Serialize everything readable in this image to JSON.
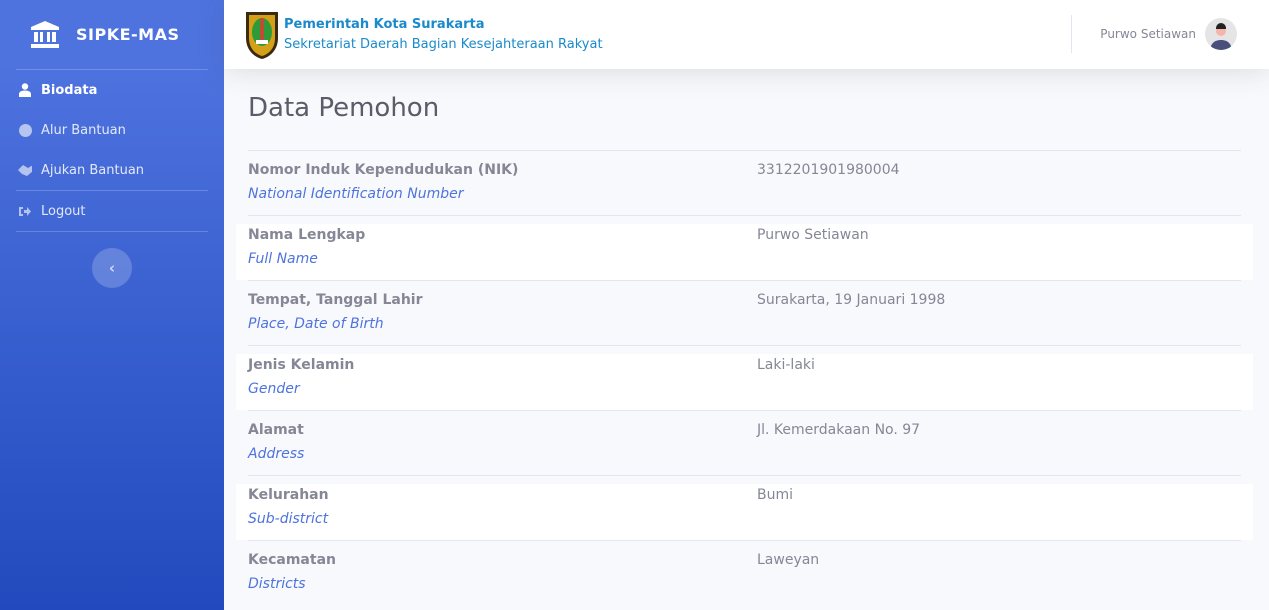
{
  "brand": {
    "name": "SIPKE-MAS"
  },
  "sidebar": {
    "items": [
      {
        "label": "Biodata",
        "icon": "user-tie-icon"
      },
      {
        "label": "Alur Bantuan",
        "icon": "flow-icon"
      },
      {
        "label": "Ajukan Bantuan",
        "icon": "handshake-icon"
      },
      {
        "label": "Logout",
        "icon": "sign-out-icon"
      }
    ],
    "toggle": "‹"
  },
  "header": {
    "org_title": "Pemerintah Kota Surakarta",
    "org_subtitle": "Sekretariat Daerah Bagian Kesejahteraan Rakyat",
    "user_name": "Purwo Setiawan"
  },
  "main": {
    "title": "Data Pemohon",
    "rows": [
      {
        "label": "Nomor Induk Kependudukan (NIK)",
        "translation": "National Identification Number",
        "value": "3312201901980004"
      },
      {
        "label": "Nama Lengkap",
        "translation": "Full Name",
        "value": "Purwo Setiawan"
      },
      {
        "label": "Tempat, Tanggal Lahir",
        "translation": "Place, Date of Birth",
        "value": "Surakarta, 19 Januari 1998"
      },
      {
        "label": "Jenis Kelamin",
        "translation": "Gender",
        "value": "Laki-laki"
      },
      {
        "label": "Alamat",
        "translation": "Address",
        "value": "Jl. Kemerdakaan No. 97"
      },
      {
        "label": "Kelurahan",
        "translation": "Sub-district",
        "value": "Bumi"
      },
      {
        "label": "Kecamatan",
        "translation": "Districts",
        "value": "Laweyan"
      }
    ]
  }
}
